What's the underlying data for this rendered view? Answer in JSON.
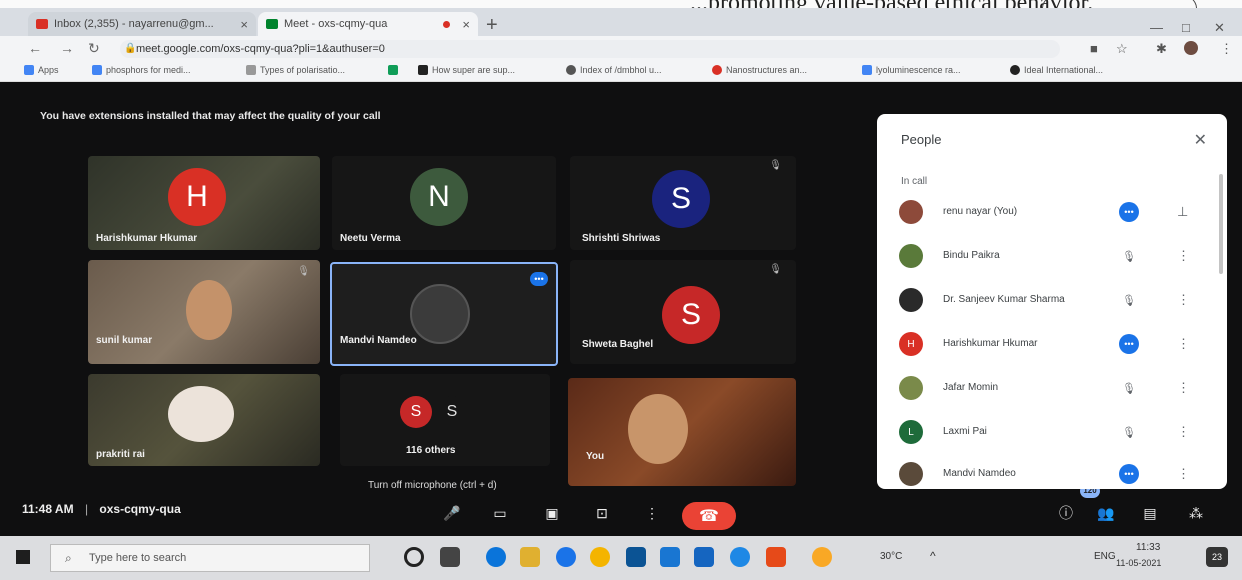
{
  "document": {
    "text": "...promoting value-based ethical behavior."
  },
  "browser": {
    "tabs": [
      {
        "title": "Inbox (2,355) - nayarrenu@gm...",
        "favicon_color": "#d93025"
      },
      {
        "title": "Meet - oxs-cqmy-qua",
        "favicon_color": "#00832d"
      }
    ],
    "new_tab": "+",
    "url": "meet.google.com/oxs-cqmy-qua?pli=1&authuser=0",
    "bookmarks": [
      {
        "label": "Apps",
        "icon_color": "#4285f4"
      },
      {
        "label": "phosphors for medi...",
        "icon_color": "#4285f4"
      },
      {
        "label": "Types of polarisatio...",
        "icon_color": "#999999"
      },
      {
        "label": "",
        "icon_color": "#0f9d58"
      },
      {
        "label": "How super are sup...",
        "icon_color": "#222222"
      },
      {
        "label": "Index of /dmbhol u...",
        "icon_color": "#555555"
      },
      {
        "label": "Nanostructures an...",
        "icon_color": "#d93025"
      },
      {
        "label": "lyoluminescence ra...",
        "icon_color": "#4285f4"
      },
      {
        "label": "Ideal International...",
        "icon_color": "#222222"
      }
    ]
  },
  "meet": {
    "extension_warning": "You have extensions installed that may affect the quality of your call",
    "tiles": [
      {
        "name": "Harishkumar Hkumar",
        "initial": "H",
        "color": "#d93025"
      },
      {
        "name": "Neetu Verma",
        "initial": "N",
        "color": "#3d5a3d"
      },
      {
        "name": "Shrishti Shriwas",
        "initial": "S",
        "color": "#1a237e"
      },
      {
        "name": "sunil kumar"
      },
      {
        "name": "Mandvi Namdeo"
      },
      {
        "name": "Shweta Baghel",
        "initial": "S",
        "color": "#c62828"
      },
      {
        "name": "prakriti rai"
      },
      {
        "name": "116 others",
        "initials": [
          "S",
          "S"
        ]
      },
      {
        "name": "You"
      }
    ],
    "time": "11:48 AM",
    "separator": "|",
    "meeting_code": "oxs-cqmy-qua",
    "mic_tooltip": "Turn off microphone (ctrl + d)",
    "participant_count": "120",
    "people_panel": {
      "title": "People",
      "section": "In call",
      "participants": [
        {
          "name": "renu nayar (You)",
          "avatar_color": "#8d4a3a",
          "status": "speaking"
        },
        {
          "name": "Bindu Paikra",
          "avatar_color": "#5a7a3a",
          "status": "muted"
        },
        {
          "name": "Dr. Sanjeev Kumar Sharma",
          "avatar_color": "#2a2a2a",
          "status": "muted"
        },
        {
          "name": "Harishkumar Hkumar",
          "avatar_color": "#d93025",
          "initial": "H",
          "status": "speaking"
        },
        {
          "name": "Jafar Momin",
          "avatar_color": "#7a8a4a",
          "status": "muted"
        },
        {
          "name": "Laxmi Pai",
          "avatar_color": "#1e6b3a",
          "initial": "L",
          "status": "muted"
        },
        {
          "name": "Mandvi Namdeo",
          "avatar_color": "#5a4a3a",
          "status": "speaking"
        }
      ]
    }
  },
  "taskbar": {
    "search_placeholder": "Type here to search",
    "temperature": "30°C",
    "language": "ENG",
    "time": "11:33",
    "date": "11-05-2021",
    "notification_count": "23"
  }
}
